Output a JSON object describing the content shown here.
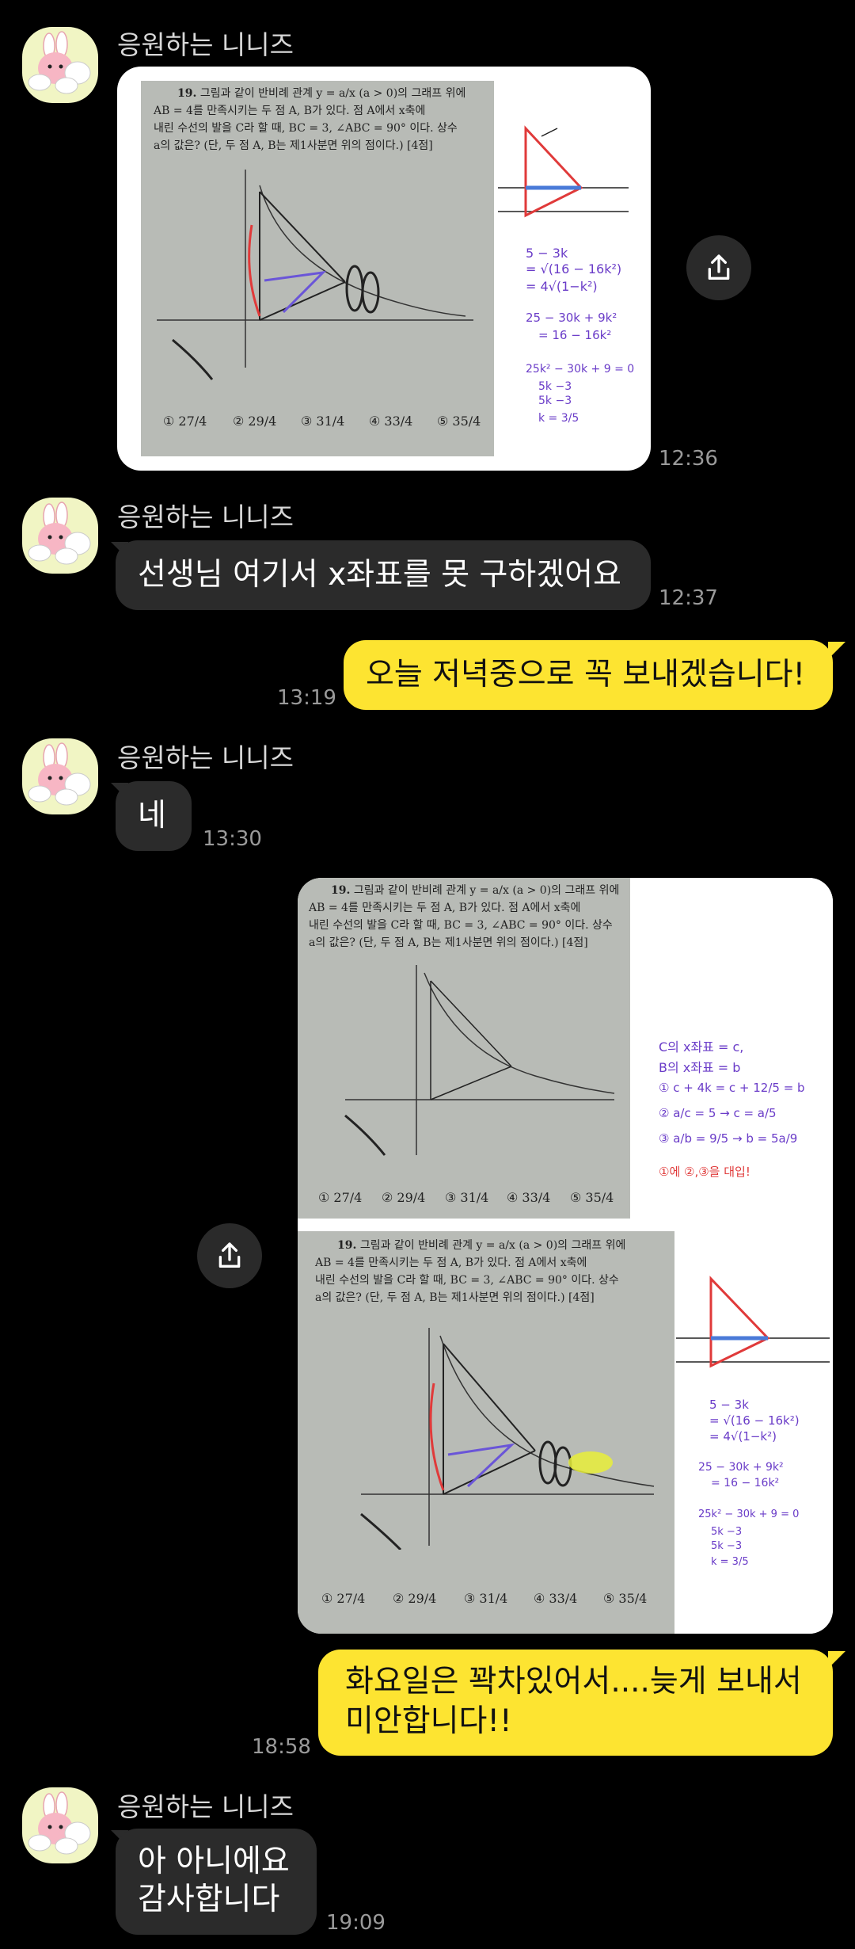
{
  "sender_name": "응원하는 니니즈",
  "messages": [
    {
      "id": "m1",
      "dir": "in",
      "type": "image",
      "time": "12:36"
    },
    {
      "id": "m2",
      "dir": "in",
      "text": "선생님 여기서 x좌표를 못 구하겠어요",
      "time": "12:37"
    },
    {
      "id": "m3",
      "dir": "out",
      "text": "오늘 저녁중으로 꼭 보내겠습니다!",
      "time": "13:19"
    },
    {
      "id": "m4",
      "dir": "in",
      "text": "네",
      "time": "13:30"
    },
    {
      "id": "m5",
      "dir": "out",
      "type": "image",
      "time": ""
    },
    {
      "id": "m6",
      "dir": "out",
      "text_line1": "화요일은 꽉차있어서....늦게 보내서",
      "text_line2": "미안합니다!!",
      "time": "18:58"
    },
    {
      "id": "m7",
      "dir": "in",
      "text_line1": "아 아니에요",
      "text_line2": "감사합니다",
      "time": "19:09"
    }
  ],
  "problem": {
    "number": "19.",
    "line1": "그림과 같이 반비례 관계 y = a/x (a > 0)의 그래프 위에",
    "line2": "AB = 4를 만족시키는 두 점 A, B가 있다. 점 A에서 x축에",
    "line3": "내린 수선의 발을 C라 할 때, BC = 3, ∠ABC = 90° 이다. 상수",
    "line4": "a의 값은? (단, 두 점 A, B는 제1사분면 위의 점이다.) [4점]",
    "choices": [
      "① 27/4",
      "② 29/4",
      "③ 31/4",
      "④ 33/4",
      "⑤ 35/4"
    ],
    "graph_label": "y = a/x"
  },
  "handwriting_1": [
    "5 − 3k",
    "= √(16 − 16k²)",
    "= 4√(1−k²)",
    "25 − 30k + 9k²",
    "= 16 − 16k²",
    "25k² − 30k + 9 = 0",
    "5k  −3",
    "5k  −3",
    "k = 3/5"
  ],
  "handwriting_2": [
    "C의 x좌표 = c,",
    "B의 x좌표 = b",
    "① c + 4k = c + 12/5 = b",
    "② a/c = 5 → c = a/5",
    "③ a/b = 9/5 → b = 5a/9",
    "①에 ②,③을 대입!"
  ]
}
